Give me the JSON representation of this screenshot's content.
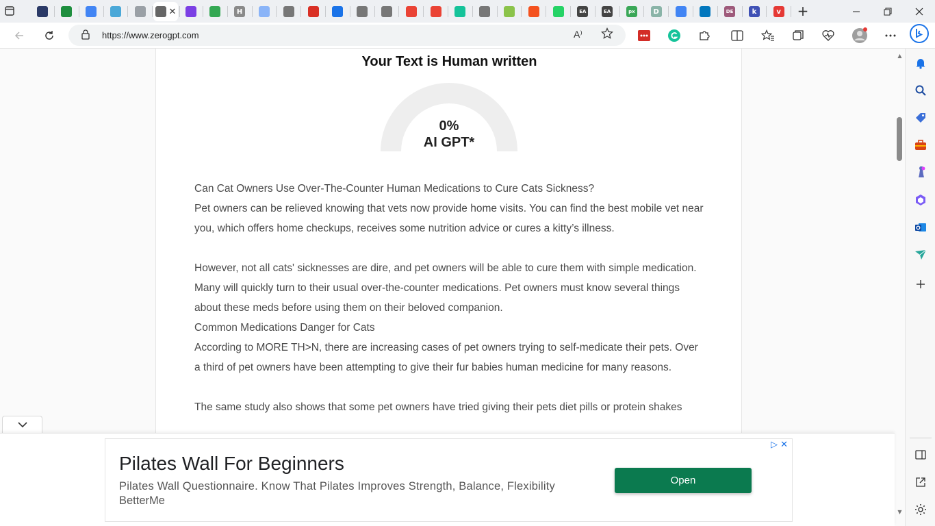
{
  "browser": {
    "tabs": [
      {
        "name": "tab-shield",
        "color": "#2b3a67"
      },
      {
        "name": "tab-sheets",
        "color": "#1e8e3e"
      },
      {
        "name": "tab-docs",
        "color": "#4285f4"
      },
      {
        "name": "tab-grid",
        "color": "#4aa8d8"
      },
      {
        "name": "tab-page",
        "color": "#9aa0a6"
      },
      {
        "name": "tab-active",
        "color": "#666666"
      },
      {
        "name": "tab-purple",
        "color": "#7b3fe4"
      },
      {
        "name": "tab-sheets2",
        "color": "#34a853"
      },
      {
        "name": "tab-h",
        "color": "#8a8a8a"
      },
      {
        "name": "tab-mail",
        "color": "#8ab4f8"
      },
      {
        "name": "tab-ban",
        "color": "#777777"
      },
      {
        "name": "tab-doc-red",
        "color": "#d93025"
      },
      {
        "name": "tab-doc-blue",
        "color": "#1a73e8"
      },
      {
        "name": "tab-ban2",
        "color": "#777777"
      },
      {
        "name": "tab-lock",
        "color": "#777777"
      },
      {
        "name": "tab-gmail",
        "color": "#ea4335"
      },
      {
        "name": "tab-gmail2",
        "color": "#ea4335"
      },
      {
        "name": "tab-grammarly",
        "color": "#15c39a"
      },
      {
        "name": "tab-lock2",
        "color": "#777777"
      },
      {
        "name": "tab-leaf",
        "color": "#8bc34a"
      },
      {
        "name": "tab-orange",
        "color": "#f4511e"
      },
      {
        "name": "tab-whatsapp",
        "color": "#25d366"
      },
      {
        "name": "tab-ea",
        "color": "#444444"
      },
      {
        "name": "tab-ea2",
        "color": "#444444"
      },
      {
        "name": "tab-px",
        "color": "#3aa757"
      },
      {
        "name": "tab-d",
        "color": "#8ab4a8"
      },
      {
        "name": "tab-google",
        "color": "#4285f4"
      },
      {
        "name": "tab-blue-bar",
        "color": "#0277bd"
      },
      {
        "name": "tab-dec",
        "color": "#9e5a7b"
      },
      {
        "name": "tab-k",
        "color": "#3f51b5"
      },
      {
        "name": "tab-v",
        "color": "#e53935"
      }
    ],
    "tab_h_letter": "H",
    "tab_px_letters": "px",
    "tab_d_letter": "D",
    "tab_k_letter": "k",
    "tab_v_letter": "v",
    "tab_dec_letters": "DE",
    "tab_ea_letters": "EA",
    "new_tab_label": "+",
    "url": "https://www.zerogpt.com",
    "read_aloud_label": "A⁾"
  },
  "colors": {
    "accent_green": "#0b7a4f",
    "gauge_track": "#eeeeee",
    "adchoices_blue": "#1a73e8"
  },
  "result": {
    "title": "Your Text is Human written",
    "percent": "0%",
    "percent_value": 0,
    "label": "AI GPT*"
  },
  "article": {
    "paragraphs": [
      "Can Cat Owners Use Over-The-Counter Human Medications to Cure Cats Sickness?",
      "Pet owners can be relieved knowing that vets now provide home visits. You can find the best mobile vet near you, which offers home checkups, receives some nutrition advice or cures a kitty’s illness.",
      "",
      "However, not all cats' sicknesses are dire, and pet owners will be able to cure them with simple medication. Many will quickly turn to their usual over-the-counter medications. Pet owners must know several things about these meds before using them on their beloved companion.",
      "Common Medications Danger for Cats",
      "According to MORE TH>N, there are increasing cases of pet owners trying to self-medicate their pets. Over a third of pet owners have been attempting to give their fur babies human medicine for many reasons.",
      "",
      "The same study also shows that some pet owners have tried giving their pets diet pills or protein shakes"
    ]
  },
  "ad": {
    "headline": "Pilates Wall For Beginners",
    "description": "Pilates Wall Questionnaire. Know That Pilates Improves Strength, Balance, Flexibility",
    "advertiser": "BetterMe",
    "cta": "Open",
    "choices_glyphs": "▷ ✕"
  }
}
